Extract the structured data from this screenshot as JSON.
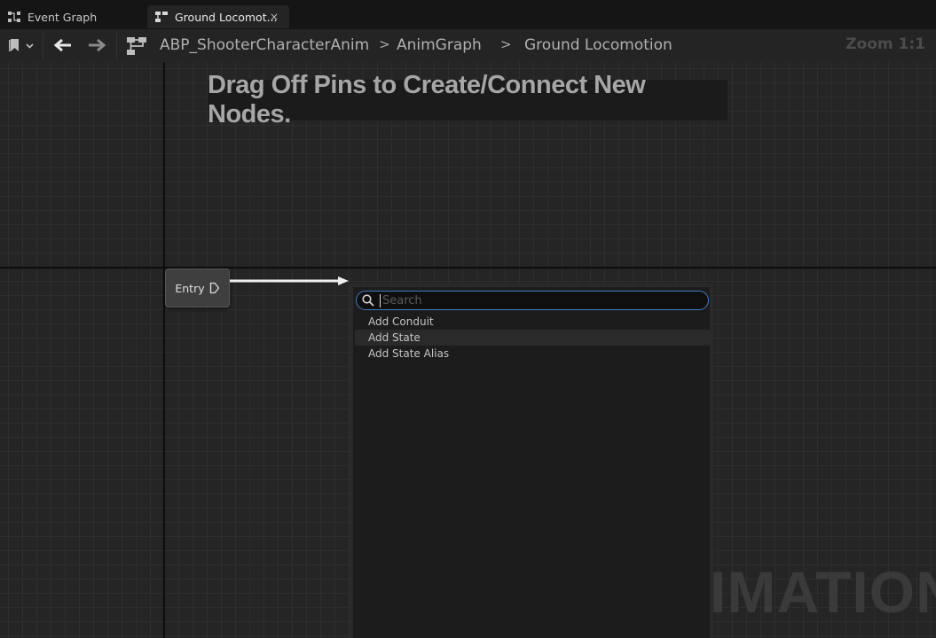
{
  "tabs": [
    {
      "label": "Event Graph",
      "icon": "event-graph-icon",
      "active": false
    },
    {
      "label": "Ground Locomot...",
      "icon": "state-machine-icon",
      "active": true,
      "close": "×"
    }
  ],
  "breadcrumb": {
    "items": [
      "ABP_ShooterCharacterAnim",
      "AnimGraph",
      "Ground Locomotion"
    ],
    "separator": ">"
  },
  "zoom_label": "Zoom 1:1",
  "graph": {
    "hint": "Drag Off Pins to Create/Connect New Nodes.",
    "entry_label": "Entry",
    "watermark": "IMATION"
  },
  "context_menu": {
    "search_placeholder": "Search",
    "search_value": "",
    "items": [
      "Add Conduit",
      "Add State",
      "Add State Alias"
    ],
    "hovered_item": "Add State"
  },
  "colors": {
    "accent": "#3d7bc4",
    "background": "#1b1b1b",
    "canvas": "#252525"
  }
}
